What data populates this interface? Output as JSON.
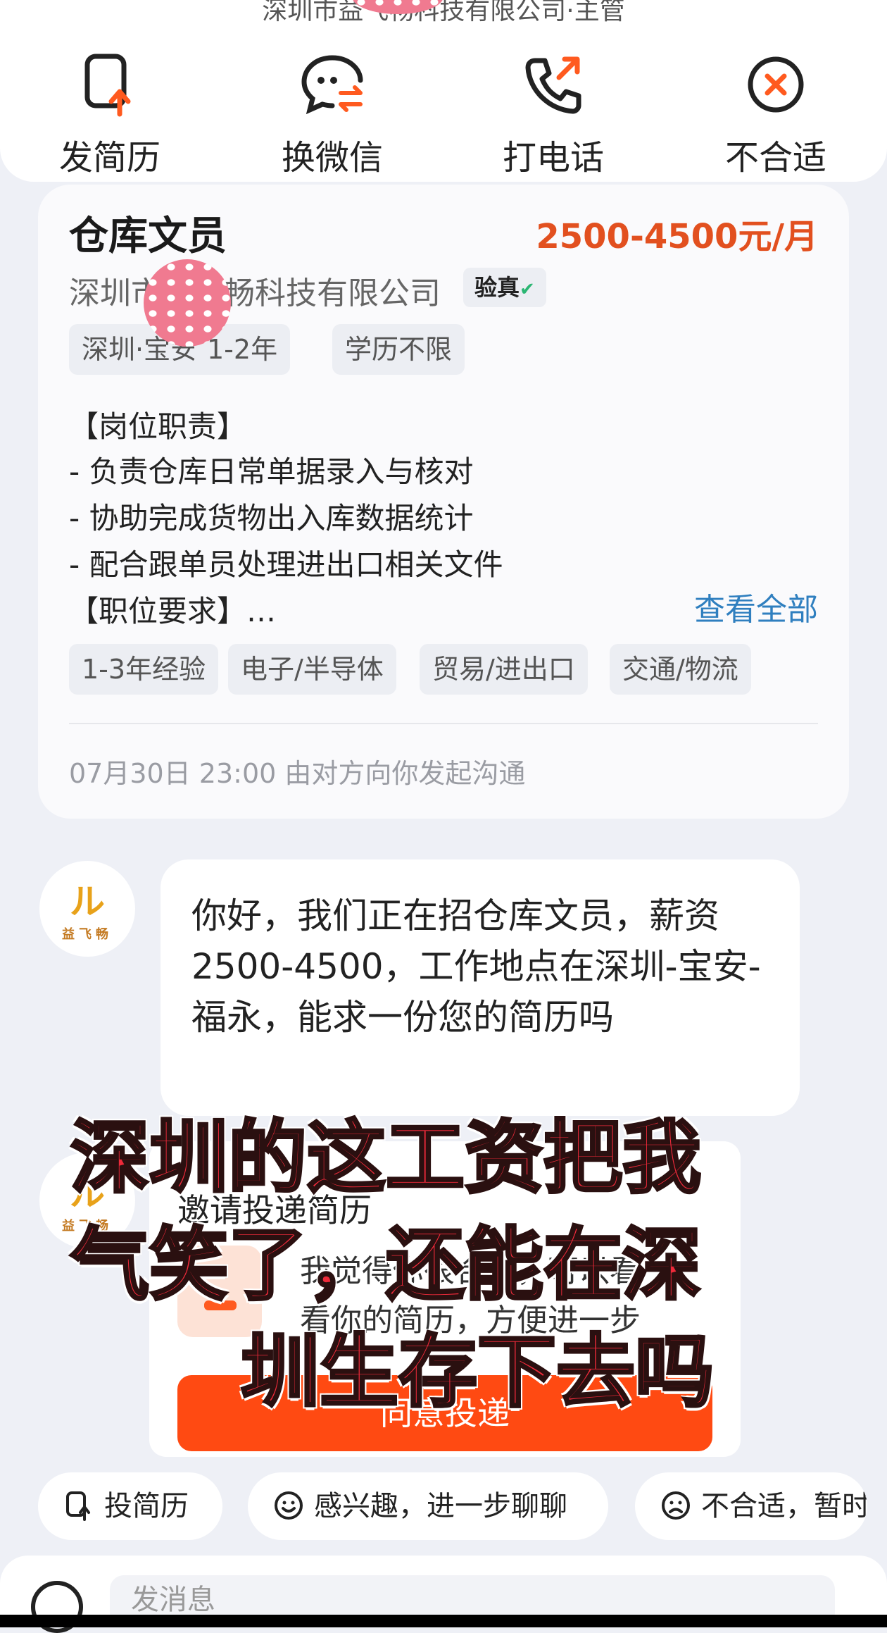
{
  "header": {
    "company_role": "深圳市益飞畅科技有限公司·主管"
  },
  "actions": [
    {
      "label": "发简历",
      "icon": "resume-upload-icon"
    },
    {
      "label": "换微信",
      "icon": "wechat-swap-icon"
    },
    {
      "label": "打电话",
      "icon": "phone-call-icon"
    },
    {
      "label": "不合适",
      "icon": "close-circle-icon"
    }
  ],
  "job": {
    "title": "仓库文员",
    "salary": "2500-4500元/月",
    "company": "深圳市益飞畅科技有限公司",
    "verified_label": "验真",
    "tags": [
      "深圳·宝安",
      "1-2年",
      "学历不限"
    ],
    "duty_header": "【岗位职责】",
    "duties": [
      "- 负责仓库日常单据录入与核对",
      "- 协助完成货物出入库数据统计",
      "- 配合跟单员处理进出口相关文件"
    ],
    "req_header": "【职位要求】…",
    "view_all": "查看全部",
    "industry_tags": [
      "1-3年经验",
      "电子/半导体",
      "贸易/进出口",
      "交通/物流"
    ],
    "timeline": "07月30日 23:00 由对方向你发起沟通"
  },
  "chat": {
    "avatar_brand": "益飞畅",
    "avatar_glyph": "ル",
    "message": "你好，我们正在招仓库文员，薪资2500-4500，工作地点在深圳-宝安-福永，能求一份您的简历吗",
    "invite_title": "邀请投递简历",
    "invite_text_1": "我觉得你很合适，可以看",
    "invite_text_2": "看你的简历，方便进一步",
    "agree_button": "同意投递"
  },
  "caption": {
    "line1": "深圳的这工资把我",
    "line2": "气笑了，还能在深",
    "line3": "圳生存下去吗"
  },
  "quick_replies": [
    {
      "label": "投简历",
      "icon": "resume-icon"
    },
    {
      "label": "感兴趣，进一步聊聊",
      "icon": "smile-icon"
    },
    {
      "label": "不合适，暂时不考虑",
      "icon": "sad-icon"
    }
  ],
  "input": {
    "placeholder": "发消息"
  },
  "colors": {
    "salary": "#e2501f",
    "accent_orange": "#ff4a12",
    "link_blue": "#2f7fbf",
    "caption_red": "#ee2a3a"
  }
}
